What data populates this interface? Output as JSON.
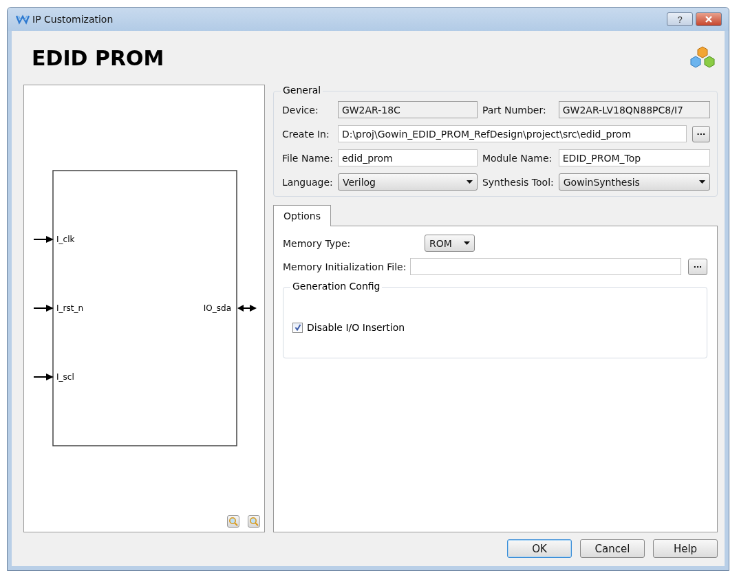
{
  "window": {
    "title": "IP Customization",
    "help": "?"
  },
  "heading": "EDID PROM",
  "diagram": {
    "inputs": [
      "I_clk",
      "I_rst_n",
      "I_scl"
    ],
    "bidirectional": [
      "IO_sda"
    ]
  },
  "general": {
    "title": "General",
    "rows": [
      [
        {
          "label": "Device:",
          "value": "GW2AR-18C",
          "kind": "readonly"
        },
        {
          "label": "Part Number:",
          "value": "GW2AR-LV18QN88PC8/I7",
          "kind": "readonly"
        }
      ],
      [
        {
          "label": "Create In:",
          "value": "D:\\proj\\Gowin_EDID_PROM_RefDesign\\project\\src\\edid_prom",
          "kind": "path",
          "browse": "..."
        }
      ],
      [
        {
          "label": "File Name:",
          "value": "edid_prom",
          "kind": "text"
        },
        {
          "label": "Module Name:",
          "value": "EDID_PROM_Top",
          "kind": "text"
        }
      ],
      [
        {
          "label": "Language:",
          "value": "Verilog",
          "kind": "dropdown"
        },
        {
          "label": "Synthesis Tool:",
          "value": "GowinSynthesis",
          "kind": "dropdown"
        }
      ]
    ]
  },
  "tabs": [
    {
      "label": "Options",
      "selected": true
    }
  ],
  "options": {
    "memory_type": {
      "label": "Memory Type:",
      "value": "ROM"
    },
    "init_file": {
      "label": "Memory Initialization File:",
      "browse": "..."
    },
    "generation_config": {
      "title": "Generation Config",
      "checkbox": {
        "label": "Disable I/O Insertion",
        "checked": true
      }
    }
  },
  "buttons": [
    {
      "label": "OK",
      "default": true
    },
    {
      "label": "Cancel",
      "default": false
    },
    {
      "label": "Help",
      "default": false
    }
  ]
}
